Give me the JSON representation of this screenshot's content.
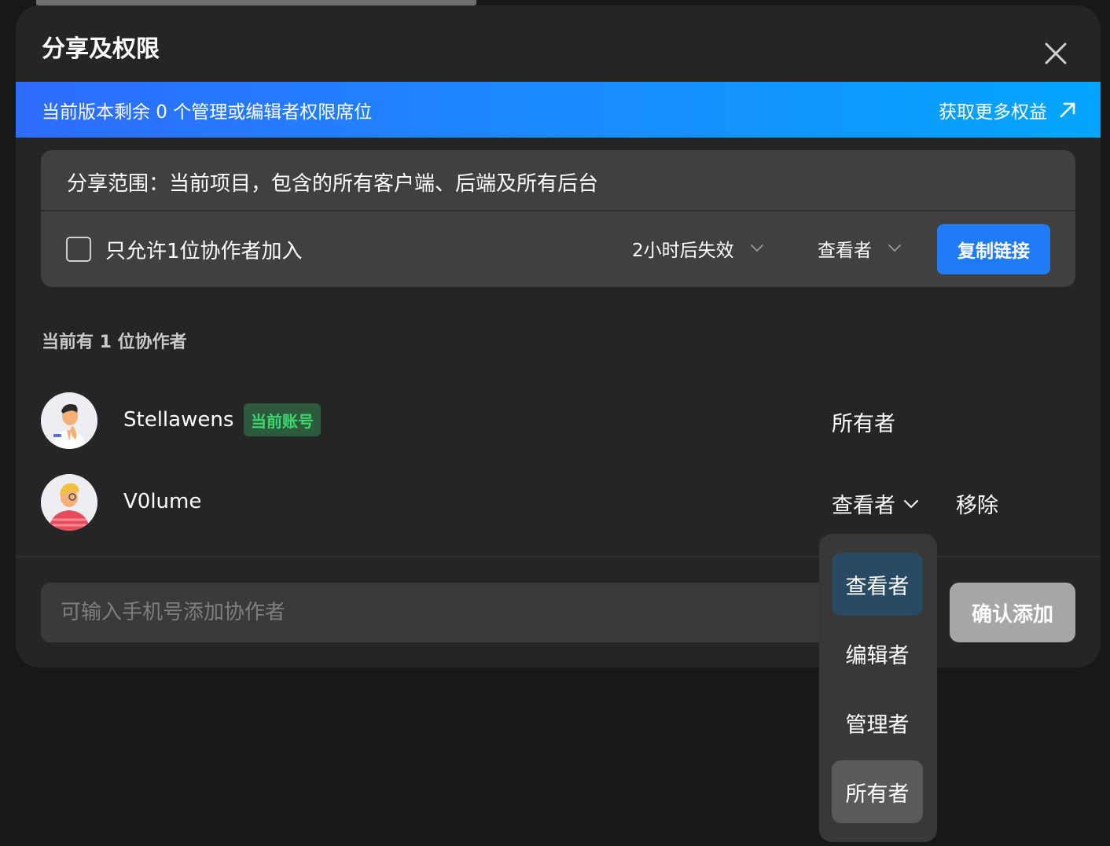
{
  "dialog": {
    "title": "分享及权限",
    "close_icon": "close-icon"
  },
  "banner": {
    "text": "当前版本剩余 0 个管理或编辑者权限席位",
    "link_label": "获取更多权益",
    "link_icon": "arrow-up-right-icon"
  },
  "share": {
    "scope_text": "分享范围：当前项目，包含的所有客户端、后端及所有后台",
    "single_collaborator_label": "只允许1位协作者加入",
    "expiry_value": "2小时后失效",
    "permission_value": "查看者",
    "copy_button": "复制链接"
  },
  "collaborators": {
    "heading": "当前有 1 位协作者",
    "members": [
      {
        "name": "Stellawens",
        "badge": "当前账号",
        "role": "所有者"
      },
      {
        "name": "V0lume",
        "role": "查看者",
        "remove_label": "移除"
      }
    ]
  },
  "add": {
    "placeholder": "可输入手机号添加协作者",
    "confirm_button": "确认添加"
  },
  "role_dropdown": {
    "options": [
      "查看者",
      "编辑者",
      "管理者",
      "所有者"
    ],
    "selected": "查看者",
    "hovered": "所有者"
  },
  "colors": {
    "accent": "#1f7cf6",
    "badge_text": "#3dd56d",
    "badge_bg": "#2d5a3c",
    "dialog_bg": "#252525"
  }
}
